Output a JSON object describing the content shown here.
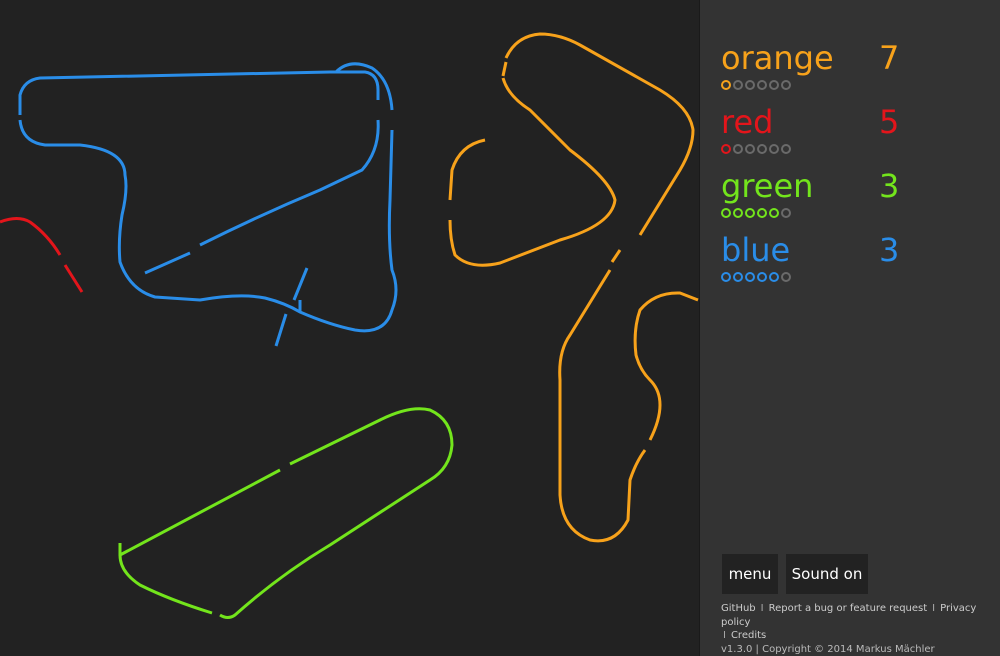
{
  "players": [
    {
      "name": "orange",
      "score": "7",
      "color": "#f7a21b",
      "rounds_won": 1,
      "rounds_total": 6
    },
    {
      "name": "red",
      "score": "5",
      "color": "#e3151b",
      "rounds_won": 1,
      "rounds_total": 6
    },
    {
      "name": "green",
      "score": "3",
      "color": "#73e51c",
      "rounds_won": 5,
      "rounds_total": 6
    },
    {
      "name": "blue",
      "score": "3",
      "color": "#2a8de8",
      "rounds_won": 5,
      "rounds_total": 6
    }
  ],
  "buttons": {
    "menu": "menu",
    "sound": "Sound on"
  },
  "footer": {
    "github": "GitHub",
    "bug": "Report a bug or feature request",
    "privacy": "Privacy policy",
    "credits": "Credits",
    "version": "v1.3.0 | Copyright © 2014 Markus Mächler"
  }
}
